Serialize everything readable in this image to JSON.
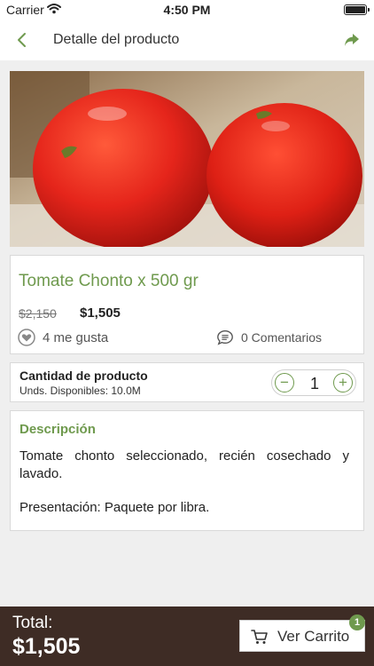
{
  "status_bar": {
    "carrier": "Carrier",
    "time": "4:50 PM"
  },
  "nav": {
    "title": "Detalle del producto",
    "back_icon": "chevron-left-icon",
    "share_icon": "share-arrow-icon"
  },
  "product": {
    "image_icon": "product-photo-tomatoes",
    "name": "Tomate Chonto x 500 gr",
    "old_price": "$2,150",
    "price": "$1,505",
    "likes": "4 me gusta",
    "comments": "0 Comentarios"
  },
  "quantity": {
    "title": "Cantidad de producto",
    "available": "Unds. Disponibles: 10.0M",
    "minus": "−",
    "value": "1",
    "plus": "+"
  },
  "description": {
    "title": "Descripción",
    "body": "Tomate chonto seleccionado, recién cosechado y lavado.",
    "presentation": "Presentación: Paquete por libra."
  },
  "footer": {
    "total_label": "Total:",
    "total_value": "$1,505",
    "cart_label": "Ver Carrito",
    "cart_count": "1"
  },
  "colors": {
    "accent": "#6f9a4e",
    "footer_bg": "#3e2c25",
    "background": "#efefef"
  }
}
